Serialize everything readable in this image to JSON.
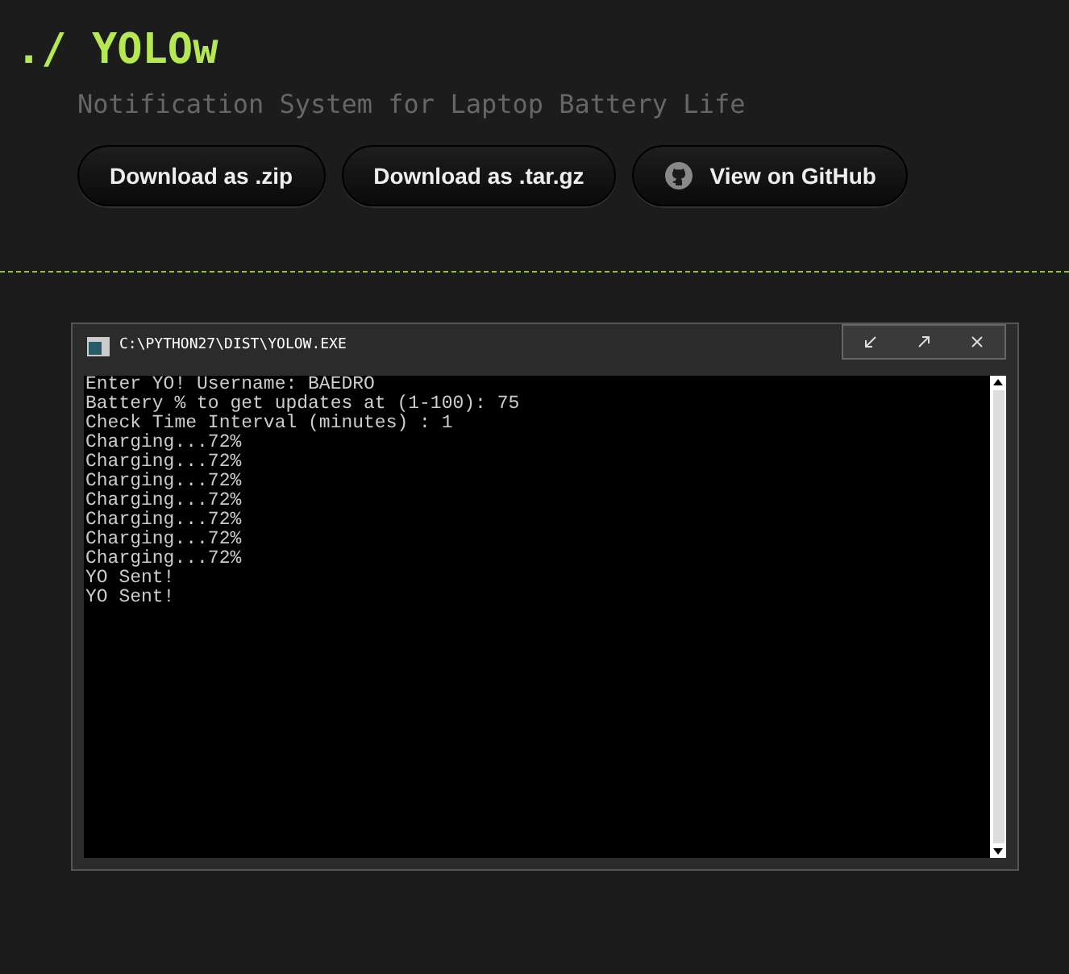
{
  "header": {
    "title": "./ YOLOw",
    "subtitle": "Notification System for Laptop Battery Life"
  },
  "buttons": [
    {
      "label": "Download as .zip",
      "kind": "plain"
    },
    {
      "label": "Download as .tar.gz",
      "kind": "plain"
    },
    {
      "label": "View on GitHub",
      "kind": "github"
    }
  ],
  "console": {
    "title": "C:\\PYTHON27\\DIST\\YOLOW.EXE",
    "lines": [
      "Enter YO! Username: BAEDRO",
      "Battery % to get updates at (1-100): 75",
      "Check Time Interval (minutes) : 1",
      "Charging...72%",
      "Charging...72%",
      "Charging...72%",
      "Charging...72%",
      "Charging...72%",
      "Charging...72%",
      "Charging...72%",
      "YO Sent!",
      "YO Sent!"
    ]
  }
}
